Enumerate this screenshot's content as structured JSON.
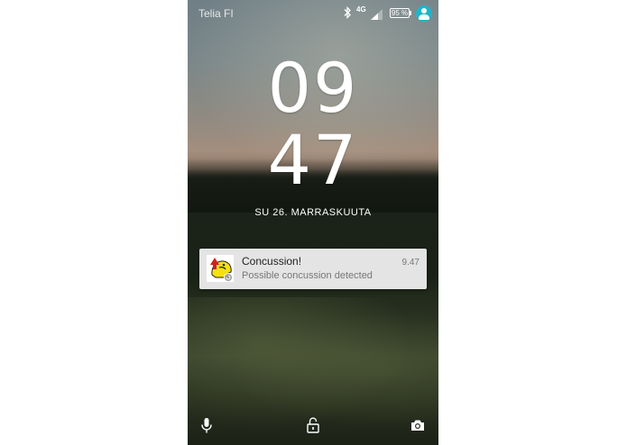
{
  "status_bar": {
    "carrier": "Telia FI",
    "network": "4G",
    "battery": "95 %",
    "icons": [
      "bluetooth-icon",
      "signal-icon",
      "battery-icon",
      "account-icon"
    ]
  },
  "lockscreen": {
    "clock_hours": "09",
    "clock_minutes": "47",
    "date": "SU 26. MARRASKUUTA"
  },
  "notification": {
    "app_icon": "concussion-app-icon",
    "title": "Concussion!",
    "text": "Possible concussion detected",
    "time": "9.47"
  },
  "bottom_bar": {
    "icons": [
      "microphone-icon",
      "unlock-icon",
      "camera-icon"
    ]
  },
  "colors": {
    "accent": "#1fb5c9",
    "notification_bg": "#f0f0f0"
  }
}
